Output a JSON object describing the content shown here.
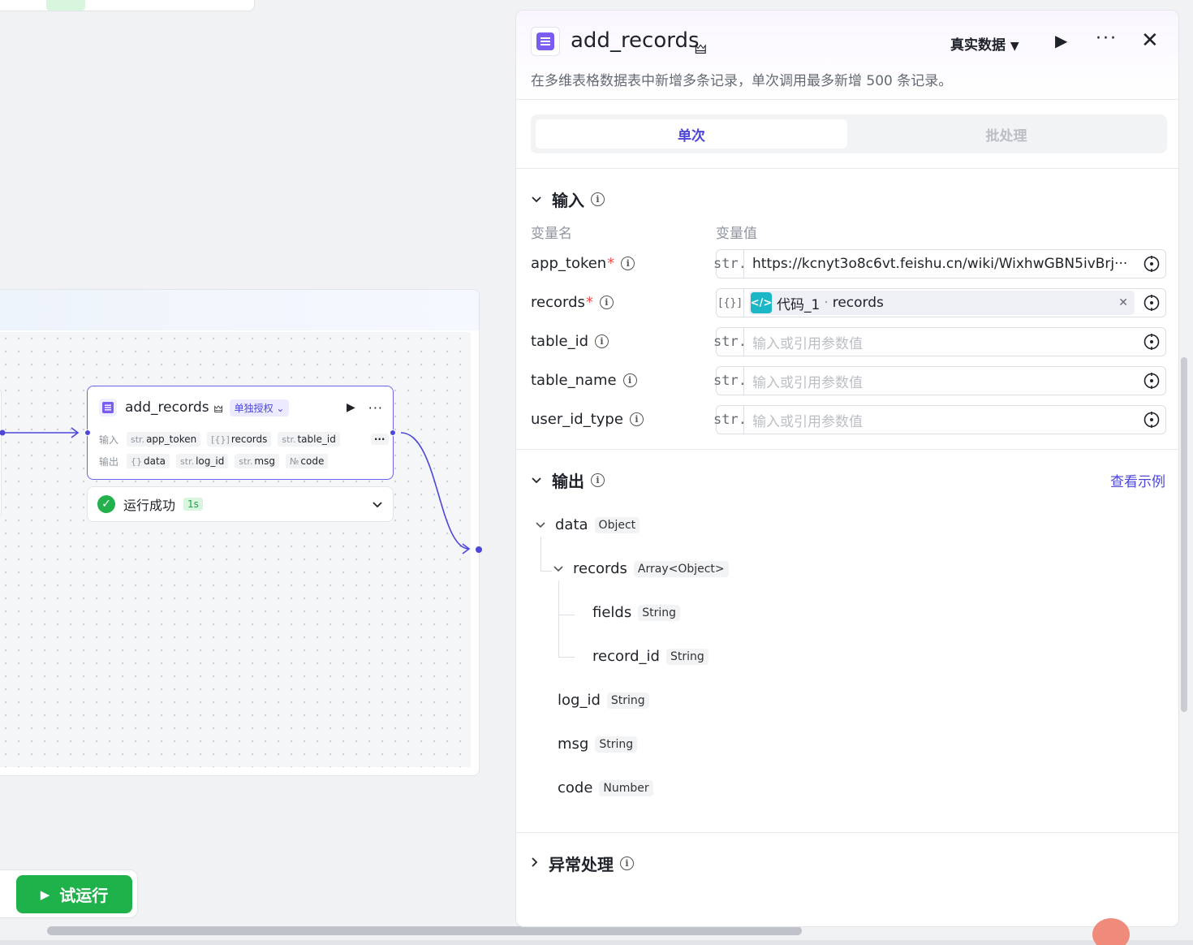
{
  "node": {
    "title": "add_records",
    "auth_tag": "单独授权",
    "input_label": "输入",
    "output_label": "输出",
    "inputs": [
      {
        "type": "str.",
        "name": "app_token"
      },
      {
        "type": "[{}]",
        "name": "records"
      },
      {
        "type": "str.",
        "name": "table_id"
      }
    ],
    "outputs": [
      {
        "type": "{}",
        "name": "data"
      },
      {
        "type": "str.",
        "name": "log_id"
      },
      {
        "type": "str.",
        "name": "msg"
      },
      {
        "type": "№",
        "name": "code"
      }
    ],
    "more_label": "···"
  },
  "status": {
    "text": "运行成功",
    "duration": "1s"
  },
  "trial_run": {
    "label": "试运行"
  },
  "panel": {
    "title": "add_records",
    "mode": "真实数据",
    "description": "在多维表格数据表中新增多条记录，单次调用最多新增 500 条记录。",
    "tabs": {
      "single": "单次",
      "batch": "批处理"
    },
    "input_section": "输入",
    "col_name": "变量名",
    "col_value": "变量值",
    "params": [
      {
        "name": "app_token",
        "required": "*",
        "type": "str.",
        "value": "https://kcnyt3o8c6vt.feishu.cn/wiki/WixhwGBN5ivBrj···",
        "placeholder": ""
      },
      {
        "name": "records",
        "required": "*",
        "type": "[{}]",
        "ref_node": "代码_1",
        "ref_dot": "·",
        "ref_field": "records"
      },
      {
        "name": "table_id",
        "required": "",
        "type": "str.",
        "value": "",
        "placeholder": "输入或引用参数值"
      },
      {
        "name": "table_name",
        "required": "",
        "type": "str.",
        "value": "",
        "placeholder": "输入或引用参数值"
      },
      {
        "name": "user_id_type",
        "required": "",
        "type": "str.",
        "value": "",
        "placeholder": "输入或引用参数值"
      }
    ],
    "output_section": "输出",
    "view_example": "查看示例",
    "output_tree": [
      {
        "name": "data",
        "type": "Object"
      },
      {
        "name": "records",
        "type": "Array<Object>"
      },
      {
        "name": "fields",
        "type": "String"
      },
      {
        "name": "record_id",
        "type": "String"
      },
      {
        "name": "log_id",
        "type": "String"
      },
      {
        "name": "msg",
        "type": "String"
      },
      {
        "name": "code",
        "type": "Number"
      }
    ],
    "exception_section": "异常处理"
  },
  "colors": {
    "accent": "#4c46d9",
    "success": "#1fb14a",
    "required": "#f54a45"
  }
}
